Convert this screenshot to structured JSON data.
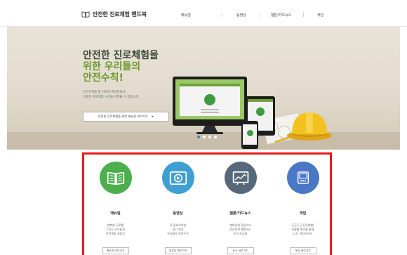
{
  "header": {
    "logo_icon": "book-outline-icon",
    "title": "안전한 진로체험 핸드북",
    "nav": [
      {
        "label": "매뉴얼"
      },
      {
        "label": "동영상"
      },
      {
        "label": "웹툰/카드뉴스"
      },
      {
        "label": "게임"
      }
    ]
  },
  "hero": {
    "headline": [
      "안전한 진로체험을",
      "위한 우리들의",
      "안전수칙!"
    ],
    "sub": [
      "안전수칙을 잘 지켜야 여러분들의",
      "소중한 진로체험 시간을 지켜줄 수 있습니다."
    ],
    "button": {
      "label": "안전한 진로체험을 위한 매뉴얼 바로가기",
      "arrow": "▸"
    },
    "slides": {
      "count": 4,
      "active_index": 0
    },
    "accent_color": "#6a9a2f"
  },
  "services": [
    {
      "title": "매뉴얼",
      "icon": "book-icon",
      "color": "#4cae4c",
      "desc": [
        "행복한 진로를",
        "그리는 우리들의",
        "안전체험 길잡이"
      ],
      "button": "매뉴얼 바로가기"
    },
    {
      "title": "동영상",
      "icon": "video-play-icon",
      "color": "#3f9fd2",
      "desc": [
        "꼭 필요하지만",
        "잊기 쉬운",
        "우리들의 안전수칙"
      ],
      "button": "동영상 바로가기"
    },
    {
      "title": "웹툰/카드뉴스",
      "icon": "chart-card-icon",
      "color": "#57687a",
      "desc": [
        "재미있게 학습하고",
        "안전하게 행동하는",
        "우리 모습들"
      ],
      "button": "뉴스 바로가기"
    },
    {
      "title": "게임",
      "icon": "game-device-icon",
      "color": "#4b78c6",
      "desc": [
        "두근두근 진로체험!",
        "상황별 퀴즈를 통해",
        "나도 안전지키미"
      ],
      "button": "게임 바로가기"
    }
  ]
}
